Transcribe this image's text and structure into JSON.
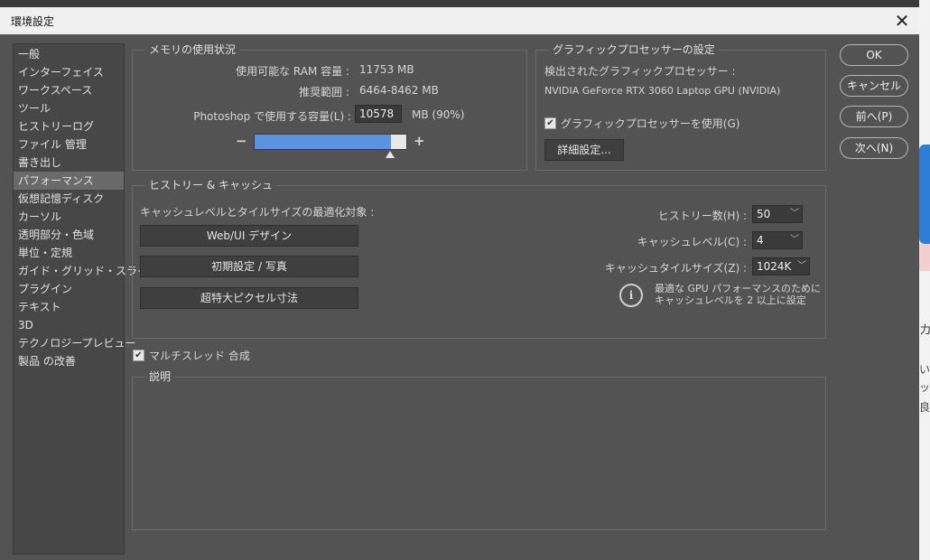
{
  "dialog": {
    "title": "環境設定"
  },
  "sidebar": {
    "items": [
      "一般",
      "インターフェイス",
      "ワークスペース",
      "ツール",
      "ヒストリーログ",
      "ファイル 管理",
      "書き出し",
      "パフォーマンス",
      "仮想記憶ディスク",
      "カーソル",
      "透明部分・色域",
      "単位・定規",
      "ガイド・グリッド・スライス",
      "プラグイン",
      "テキスト",
      "3D",
      "テクノロジープレビュー",
      "製品 の改善"
    ],
    "active_index": 7
  },
  "memory": {
    "title": "メモリの使用状況",
    "available_label": "使用可能な RAM 容量 :",
    "available_value": "11753 MB",
    "range_label": "推奨範囲 :",
    "range_value": "6464-8462 MB",
    "use_label": "Photoshop で使用する容量(L) :",
    "use_value": "10578",
    "use_unit": "MB (90%)",
    "minus": "−",
    "plus": "+",
    "slider_fraction": 0.9
  },
  "gpu": {
    "title": "グラフィックプロセッサーの設定",
    "detected_label": "検出されたグラフィックプロセッサー :",
    "gpu_name": "NVIDIA GeForce RTX 3060 Laptop GPU (NVIDIA)",
    "use_gpu_label": "グラフィックプロセッサーを使用(G)",
    "use_gpu_checked": true,
    "advanced_button": "詳細設定..."
  },
  "history": {
    "title": "ヒストリー & キャッシュ",
    "optimize_label": "キャッシュレベルとタイルサイズの最適化対象 :",
    "preset_web": "Web/UI デザイン",
    "preset_default": "初期設定 / 写真",
    "preset_huge": "超特大ピクセル寸法",
    "states_label": "ヒストリー数(H) :",
    "states_value": "50",
    "cache_levels_label": "キャッシュレベル(C) :",
    "cache_levels_value": "4",
    "tile_size_label": "キャッシュタイルサイズ(Z) :",
    "tile_size_value": "1024K",
    "info_line1": "最適な GPU パフォーマンスのために",
    "info_line2": "キャッシュレベルを 2 以上に設定"
  },
  "multithread": {
    "label": "マルチスレッド 合成",
    "checked": true
  },
  "description": {
    "title": "説明"
  },
  "buttons": {
    "ok": "OK",
    "cancel": "キャンセル",
    "prev": "前へ(P)",
    "next": "次へ(N)"
  },
  "colors": {
    "dialog_bg": "#535353",
    "sidebar_active": "#6a6a6a",
    "slider_fill": "#5b93e0"
  },
  "background": {
    "partial_text_1": "カ",
    "partial_text_2": "い",
    "partial_text_3": "ッ",
    "partial_text_4": "良し"
  }
}
